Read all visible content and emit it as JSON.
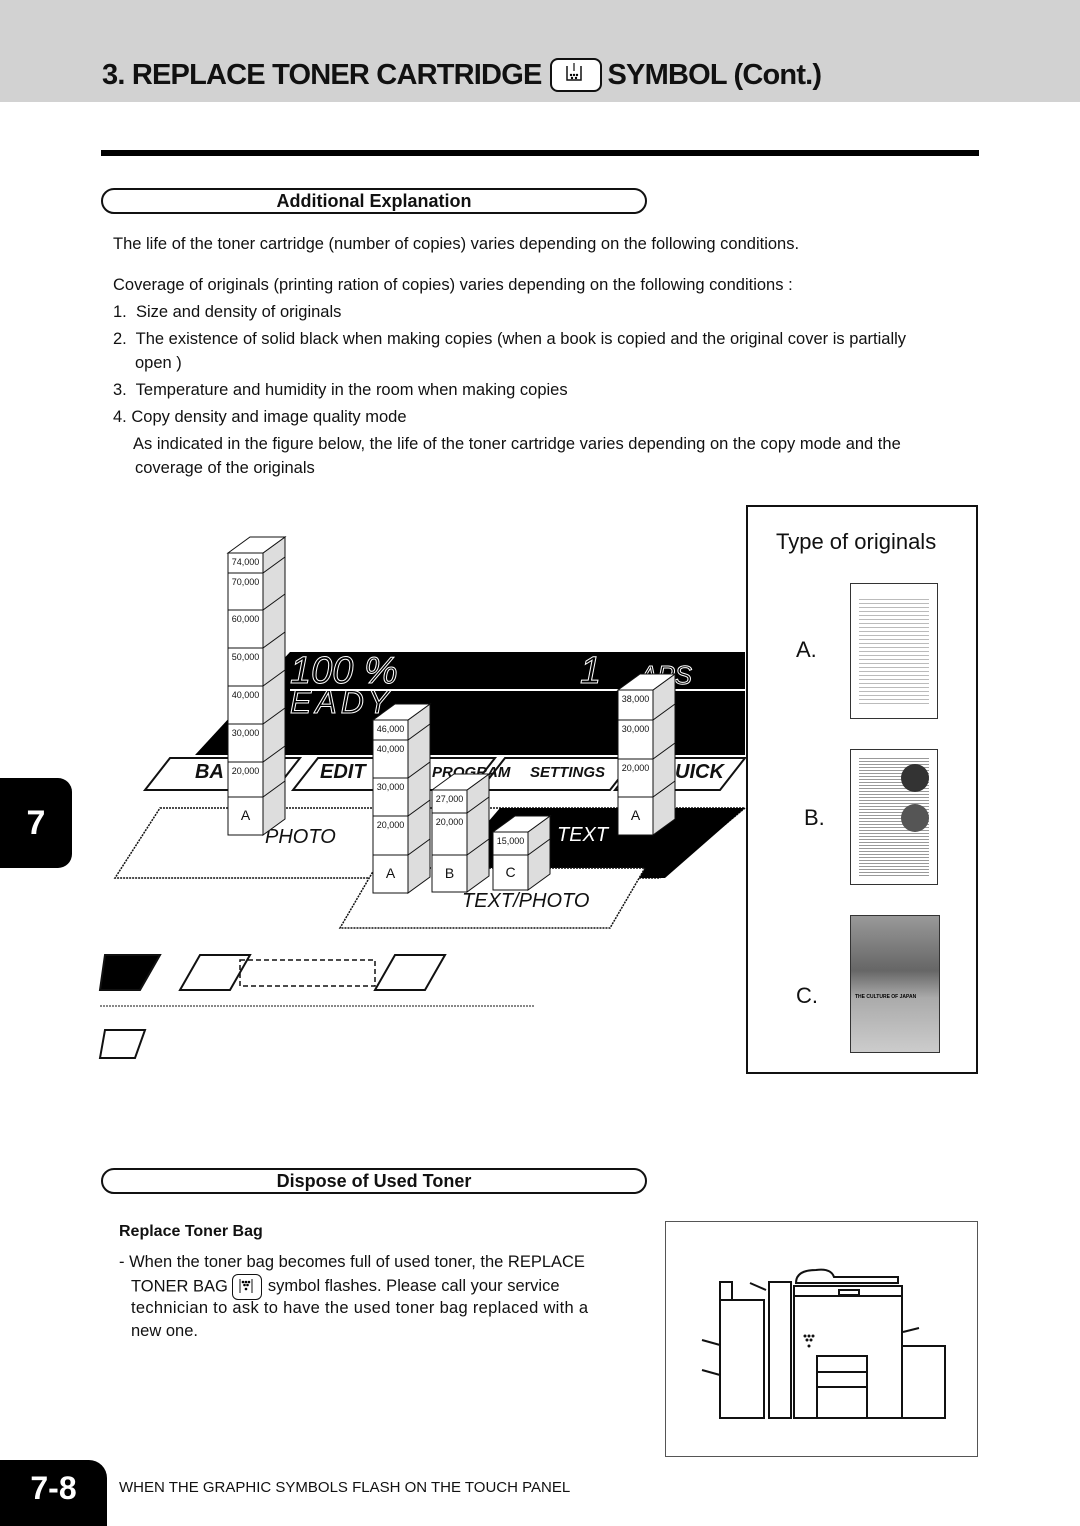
{
  "header": {
    "title_part1": "3. REPLACE TONER CARTRIDGE",
    "title_part2": "SYMBOL (Cont.)",
    "symbol_icon": "toner-cartridge-icon"
  },
  "section1": {
    "heading": "Additional Explanation",
    "intro": "The life of the toner cartridge (number of copies) varies depending on the following conditions.",
    "coverage": "Coverage of originals (printing ration of copies) varies depending on the following conditions :",
    "items": [
      {
        "num": "1.",
        "text": "Size and density of originals"
      },
      {
        "num": "2.",
        "text": "The existence of solid black when making copies (when a book is copied and the original cover is partially",
        "text2": "open )"
      },
      {
        "num": "3.",
        "text": "Temperature and humidity in the room when making copies"
      },
      {
        "num": "4.",
        "text": "Copy density and image quality mode"
      }
    ],
    "note": "As indicated in the figure below, the life of the toner cartridge varies depending on the copy mode and the",
    "note2": "coverage of the originals"
  },
  "figure": {
    "panel_labels": {
      "zoom": "100 %",
      "count": "1",
      "aps": "APS",
      "ready": "EADY",
      "tabs": [
        "BA",
        "EDIT",
        "PROGRAM",
        "SETTINGS",
        "UICK"
      ],
      "photo": "PHOTO",
      "text": "TEXT",
      "text_photo": "TEXT/PHOTO"
    },
    "bars": [
      {
        "mode": "PHOTO",
        "type": "A",
        "segments": [
          "74,000",
          "70,000",
          "60,000",
          "50,000",
          "40,000",
          "30,000",
          "20,000"
        ]
      },
      {
        "mode": "TEXT/PHOTO",
        "type": "A",
        "segments": [
          "46,000",
          "40,000",
          "30,000",
          "20,000"
        ]
      },
      {
        "mode": "TEXT/PHOTO",
        "type": "B",
        "segments": [
          "27,000",
          "20,000"
        ]
      },
      {
        "mode": "TEXT/PHOTO",
        "type": "C",
        "segments": [
          "15,000"
        ]
      },
      {
        "mode": "TEXT",
        "type": "A",
        "segments": [
          "38,000",
          "30,000",
          "20,000"
        ]
      }
    ],
    "types_title": "Type of originals",
    "types": [
      {
        "label": "A."
      },
      {
        "label": "B."
      },
      {
        "label": "C."
      }
    ],
    "thumb_c_caption": "THE CULTURE OF JAPAN"
  },
  "section2": {
    "heading": "Dispose of Used Toner",
    "subheading": "Replace Toner Bag",
    "line1": "- When the toner bag becomes full of used toner, the REPLACE",
    "line2a": "TONER BAG",
    "line2b": "symbol flashes. Please call your service",
    "line3": "technician to ask to have the used toner bag replaced with a",
    "line4": "new one.",
    "symbol_icon": "toner-bag-icon"
  },
  "side_tab": "7",
  "footer": {
    "page": "7-8",
    "text": "WHEN THE GRAPHIC SYMBOLS FLASH ON THE TOUCH PANEL"
  }
}
